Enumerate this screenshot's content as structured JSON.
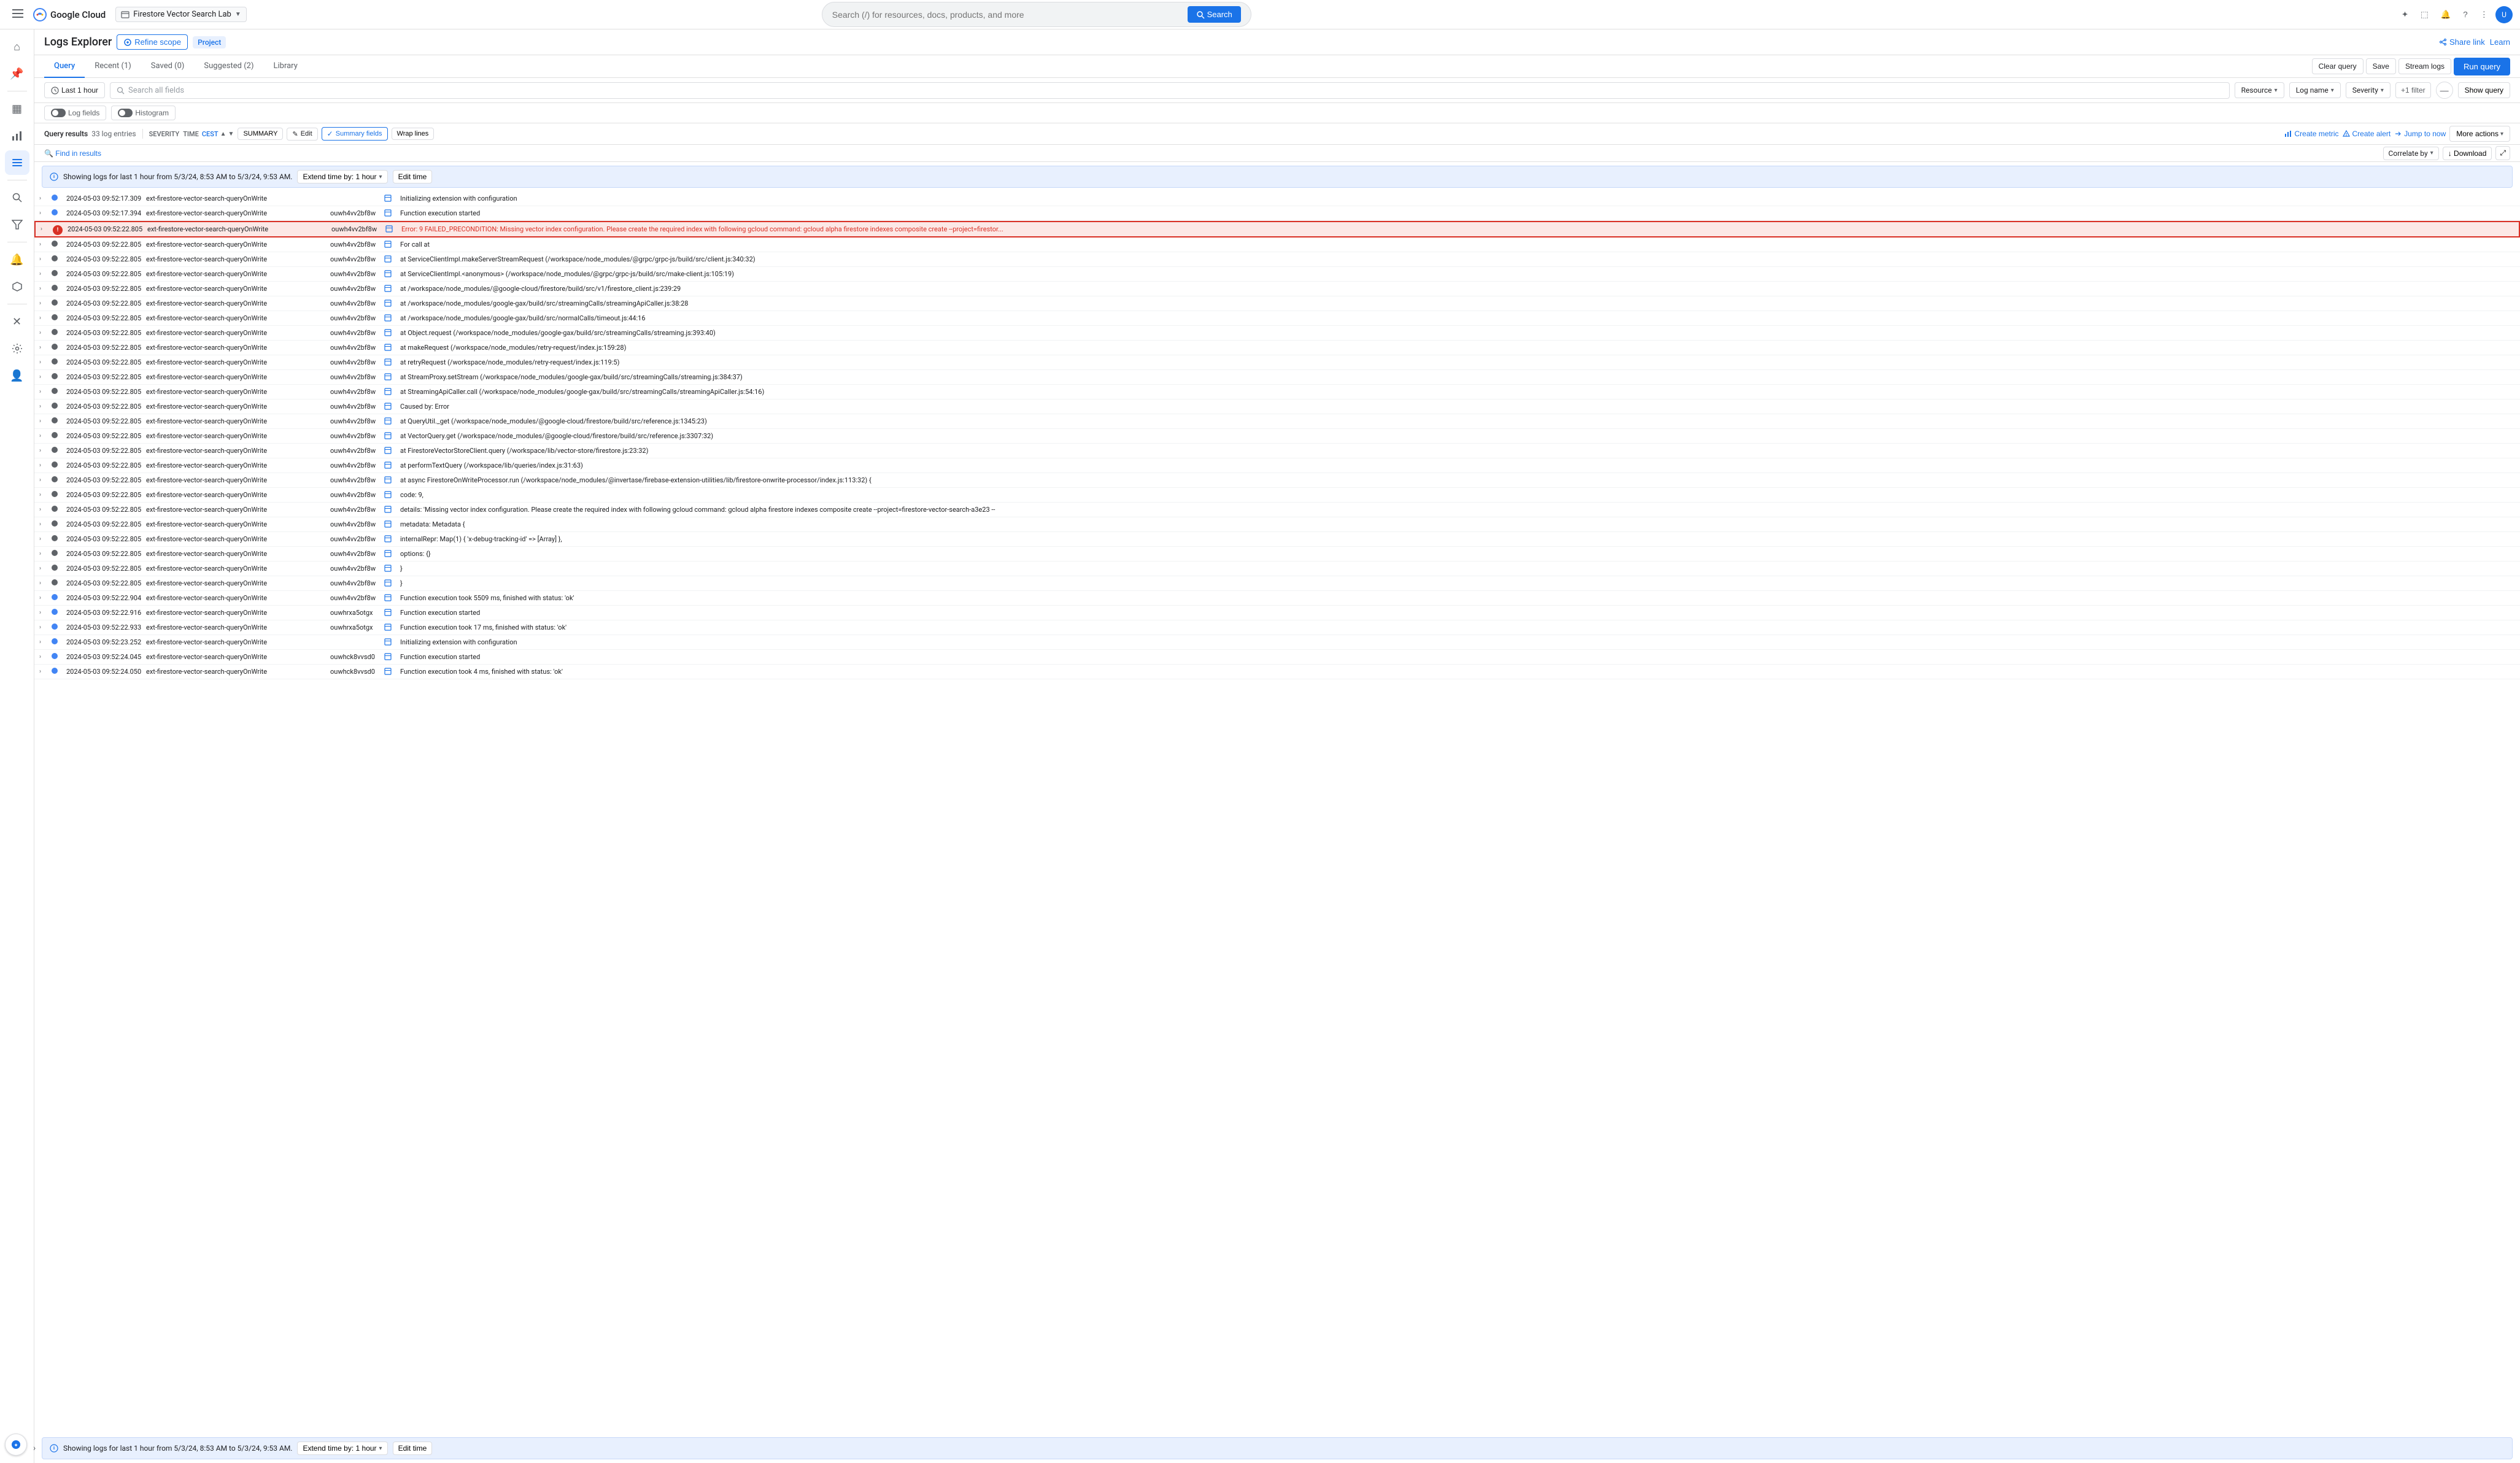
{
  "topNav": {
    "hamburger_label": "☰",
    "logo_text": "Google Cloud",
    "project_name": "Firestore Vector Search Lab",
    "search_placeholder": "Search (/) for resources, docs, products, and more",
    "search_btn": "Search"
  },
  "leftSidebar": {
    "icons": [
      {
        "name": "menu-icon",
        "symbol": "☰"
      },
      {
        "name": "home-icon",
        "symbol": "⌂"
      },
      {
        "name": "pin-icon",
        "symbol": "📌"
      },
      {
        "name": "dashboard-icon",
        "symbol": "▦"
      },
      {
        "name": "chart-icon",
        "symbol": "📊"
      },
      {
        "name": "logs-icon",
        "symbol": "📋"
      },
      {
        "name": "search-icon2",
        "symbol": "🔍"
      },
      {
        "name": "filter-icon",
        "symbol": "⊟"
      },
      {
        "name": "bell-icon",
        "symbol": "🔔"
      },
      {
        "name": "service-icon",
        "symbol": "⬡"
      },
      {
        "name": "settings-icon",
        "symbol": "⚙"
      },
      {
        "name": "user-icon",
        "symbol": "👤"
      }
    ]
  },
  "page": {
    "title": "Logs Explorer",
    "refine_scope": "Refine scope",
    "project_badge": "Project",
    "share_link": "Share link",
    "learn": "Learn"
  },
  "tabs": {
    "items": [
      {
        "label": "Query",
        "active": true
      },
      {
        "label": "Recent (1)",
        "active": false
      },
      {
        "label": "Saved (0)",
        "active": false
      },
      {
        "label": "Suggested (2)",
        "active": false
      },
      {
        "label": "Library",
        "active": false
      }
    ],
    "actions": {
      "clear_query": "Clear query",
      "save": "Save",
      "stream_logs": "Stream logs",
      "run_query": "Run query"
    }
  },
  "toolbar": {
    "time_range": "Last 1 hour",
    "search_placeholder": "Search all fields",
    "resource_label": "Resource",
    "log_name_label": "Log name",
    "severity_label": "Severity",
    "plus_filter": "+1 filter",
    "show_query": "Show query"
  },
  "subToolbar": {
    "log_fields": "Log fields",
    "histogram": "Histogram"
  },
  "resultsToolbar": {
    "query_results": "Query results",
    "log_count": "33 log entries",
    "severity_label": "SEVERITY",
    "time_label": "TIME",
    "time_zone": "CEST",
    "summary_label": "SUMMARY",
    "edit_btn": "✎ Edit",
    "summary_fields_btn": "Summary fields",
    "wrap_lines": "Wrap lines",
    "create_metric": "Create metric",
    "create_alert": "Create alert",
    "jump_to_now": "Jump to now",
    "more_actions": "More actions",
    "find_in_results": "🔍 Find in results",
    "correlate_by": "Correlate by",
    "download": "↓ Download"
  },
  "statusBar": {
    "text": "Showing logs for last 1 hour from 5/3/24, 8:53 AM to 5/3/24, 9:53 AM.",
    "extend_btn": "Extend time by: 1 hour",
    "edit_time": "Edit time"
  },
  "logRows": [
    {
      "severity": "info",
      "time": "2024-05-03 09:52:17.309",
      "function": "ext-firestore-vector-search-queryOnWrite",
      "instance": "",
      "message": "Initializing extension with configuration"
    },
    {
      "severity": "info",
      "time": "2024-05-03 09:52:17.394",
      "function": "ext-firestore-vector-search-queryOnWrite",
      "instance": "ouwh4vv2bf8w",
      "message": "Function execution started"
    },
    {
      "severity": "error",
      "time": "2024-05-03 09:52:22.805",
      "function": "ext-firestore-vector-search-queryOnWrite",
      "instance": "ouwh4vv2bf8w",
      "message": "Error: 9 FAILED_PRECONDITION: Missing vector index configuration. Please create the required index with following gcloud command: gcloud alpha firestore indexes composite create --project=firestor...",
      "highlight": true
    },
    {
      "severity": "debug",
      "time": "2024-05-03 09:52:22.805",
      "function": "ext-firestore-vector-search-queryOnWrite",
      "instance": "ouwh4vv2bf8w",
      "message": "For call at"
    },
    {
      "severity": "debug",
      "time": "2024-05-03 09:52:22.805",
      "function": "ext-firestore-vector-search-queryOnWrite",
      "instance": "ouwh4vv2bf8w",
      "message": "at ServiceClientImpl.makeServerStreamRequest (/workspace/node_modules/@grpc/grpc-js/build/src/client.js:340:32)"
    },
    {
      "severity": "debug",
      "time": "2024-05-03 09:52:22.805",
      "function": "ext-firestore-vector-search-queryOnWrite",
      "instance": "ouwh4vv2bf8w",
      "message": "at ServiceClientImpl.<anonymous> (/workspace/node_modules/@grpc/grpc-js/build/src/make-client.js:105:19)"
    },
    {
      "severity": "debug",
      "time": "2024-05-03 09:52:22.805",
      "function": "ext-firestore-vector-search-queryOnWrite",
      "instance": "ouwh4vv2bf8w",
      "message": "at /workspace/node_modules/@google-cloud/firestore/build/src/v1/firestore_client.js:239:29"
    },
    {
      "severity": "debug",
      "time": "2024-05-03 09:52:22.805",
      "function": "ext-firestore-vector-search-queryOnWrite",
      "instance": "ouwh4vv2bf8w",
      "message": "at /workspace/node_modules/google-gax/build/src/streamingCalls/streamingApiCaller.js:38:28"
    },
    {
      "severity": "debug",
      "time": "2024-05-03 09:52:22.805",
      "function": "ext-firestore-vector-search-queryOnWrite",
      "instance": "ouwh4vv2bf8w",
      "message": "at /workspace/node_modules/google-gax/build/src/normalCalls/timeout.js:44:16"
    },
    {
      "severity": "debug",
      "time": "2024-05-03 09:52:22.805",
      "function": "ext-firestore-vector-search-queryOnWrite",
      "instance": "ouwh4vv2bf8w",
      "message": "at Object.request (/workspace/node_modules/google-gax/build/src/streamingCalls/streaming.js:393:40)"
    },
    {
      "severity": "debug",
      "time": "2024-05-03 09:52:22.805",
      "function": "ext-firestore-vector-search-queryOnWrite",
      "instance": "ouwh4vv2bf8w",
      "message": "at makeRequest (/workspace/node_modules/retry-request/index.js:159:28)"
    },
    {
      "severity": "debug",
      "time": "2024-05-03 09:52:22.805",
      "function": "ext-firestore-vector-search-queryOnWrite",
      "instance": "ouwh4vv2bf8w",
      "message": "at retryRequest (/workspace/node_modules/retry-request/index.js:119:5)"
    },
    {
      "severity": "debug",
      "time": "2024-05-03 09:52:22.805",
      "function": "ext-firestore-vector-search-queryOnWrite",
      "instance": "ouwh4vv2bf8w",
      "message": "at StreamProxy.setStream (/workspace/node_modules/google-gax/build/src/streamingCalls/streaming.js:384:37)"
    },
    {
      "severity": "debug",
      "time": "2024-05-03 09:52:22.805",
      "function": "ext-firestore-vector-search-queryOnWrite",
      "instance": "ouwh4vv2bf8w",
      "message": "at StreamingApiCaller.call (/workspace/node_modules/google-gax/build/src/streamingCalls/streamingApiCaller.js:54:16)"
    },
    {
      "severity": "debug",
      "time": "2024-05-03 09:52:22.805",
      "function": "ext-firestore-vector-search-queryOnWrite",
      "instance": "ouwh4vv2bf8w",
      "message": "Caused by: Error"
    },
    {
      "severity": "debug",
      "time": "2024-05-03 09:52:22.805",
      "function": "ext-firestore-vector-search-queryOnWrite",
      "instance": "ouwh4vv2bf8w",
      "message": "at QueryUtil._get (/workspace/node_modules/@google-cloud/firestore/build/src/reference.js:1345:23)"
    },
    {
      "severity": "debug",
      "time": "2024-05-03 09:52:22.805",
      "function": "ext-firestore-vector-search-queryOnWrite",
      "instance": "ouwh4vv2bf8w",
      "message": "at VectorQuery.get (/workspace/node_modules/@google-cloud/firestore/build/src/reference.js:3307:32)"
    },
    {
      "severity": "debug",
      "time": "2024-05-03 09:52:22.805",
      "function": "ext-firestore-vector-search-queryOnWrite",
      "instance": "ouwh4vv2bf8w",
      "message": "at FirestoreVectorStoreClient.query (/workspace/lib/vector-store/firestore.js:23:32)"
    },
    {
      "severity": "debug",
      "time": "2024-05-03 09:52:22.805",
      "function": "ext-firestore-vector-search-queryOnWrite",
      "instance": "ouwh4vv2bf8w",
      "message": "at performTextQuery (/workspace/lib/queries/index.js:31:63)"
    },
    {
      "severity": "debug",
      "time": "2024-05-03 09:52:22.805",
      "function": "ext-firestore-vector-search-queryOnWrite",
      "instance": "ouwh4vv2bf8w",
      "message": "at async FirestoreOnWriteProcessor.run (/workspace/node_modules/@invertase/firebase-extension-utilities/lib/firestore-onwrite-processor/index.js:113:32) {"
    },
    {
      "severity": "debug",
      "time": "2024-05-03 09:52:22.805",
      "function": "ext-firestore-vector-search-queryOnWrite",
      "instance": "ouwh4vv2bf8w",
      "message": "code: 9,"
    },
    {
      "severity": "debug",
      "time": "2024-05-03 09:52:22.805",
      "function": "ext-firestore-vector-search-queryOnWrite",
      "instance": "ouwh4vv2bf8w",
      "message": "details: 'Missing vector index configuration. Please create the required index with following gcloud command: gcloud alpha firestore indexes composite create --project=firestore-vector-search-a3e23 --"
    },
    {
      "severity": "debug",
      "time": "2024-05-03 09:52:22.805",
      "function": "ext-firestore-vector-search-queryOnWrite",
      "instance": "ouwh4vv2bf8w",
      "message": "metadata: Metadata {"
    },
    {
      "severity": "debug",
      "time": "2024-05-03 09:52:22.805",
      "function": "ext-firestore-vector-search-queryOnWrite",
      "instance": "ouwh4vv2bf8w",
      "message": "    internalRepr: Map(1) { 'x-debug-tracking-id' => [Array] },"
    },
    {
      "severity": "debug",
      "time": "2024-05-03 09:52:22.805",
      "function": "ext-firestore-vector-search-queryOnWrite",
      "instance": "ouwh4vv2bf8w",
      "message": "    options: {}"
    },
    {
      "severity": "debug",
      "time": "2024-05-03 09:52:22.805",
      "function": "ext-firestore-vector-search-queryOnWrite",
      "instance": "ouwh4vv2bf8w",
      "message": "  }"
    },
    {
      "severity": "debug",
      "time": "2024-05-03 09:52:22.805",
      "function": "ext-firestore-vector-search-queryOnWrite",
      "instance": "ouwh4vv2bf8w",
      "message": "}"
    },
    {
      "severity": "info",
      "time": "2024-05-03 09:52:22.904",
      "function": "ext-firestore-vector-search-queryOnWrite",
      "instance": "ouwh4vv2bf8w",
      "message": "Function execution took 5509 ms, finished with status: 'ok'"
    },
    {
      "severity": "info",
      "time": "2024-05-03 09:52:22.916",
      "function": "ext-firestore-vector-search-queryOnWrite",
      "instance": "ouwhrxa5otgx",
      "message": "Function execution started"
    },
    {
      "severity": "info",
      "time": "2024-05-03 09:52:22.933",
      "function": "ext-firestore-vector-search-queryOnWrite",
      "instance": "ouwhrxa5otgx",
      "message": "Function execution took 17 ms, finished with status: 'ok'"
    },
    {
      "severity": "info",
      "time": "2024-05-03 09:52:23.252",
      "function": "ext-firestore-vector-search-queryOnWrite",
      "instance": "",
      "message": "Initializing extension with configuration"
    },
    {
      "severity": "info",
      "time": "2024-05-03 09:52:24.045",
      "function": "ext-firestore-vector-search-queryOnWrite",
      "instance": "ouwhck8vvsd0",
      "message": "Function execution started"
    },
    {
      "severity": "info",
      "time": "2024-05-03 09:52:24.050",
      "function": "ext-firestore-vector-search-queryOnWrite",
      "instance": "ouwhck8vvsd0",
      "message": "Function execution took 4 ms, finished with status: 'ok'"
    }
  ]
}
